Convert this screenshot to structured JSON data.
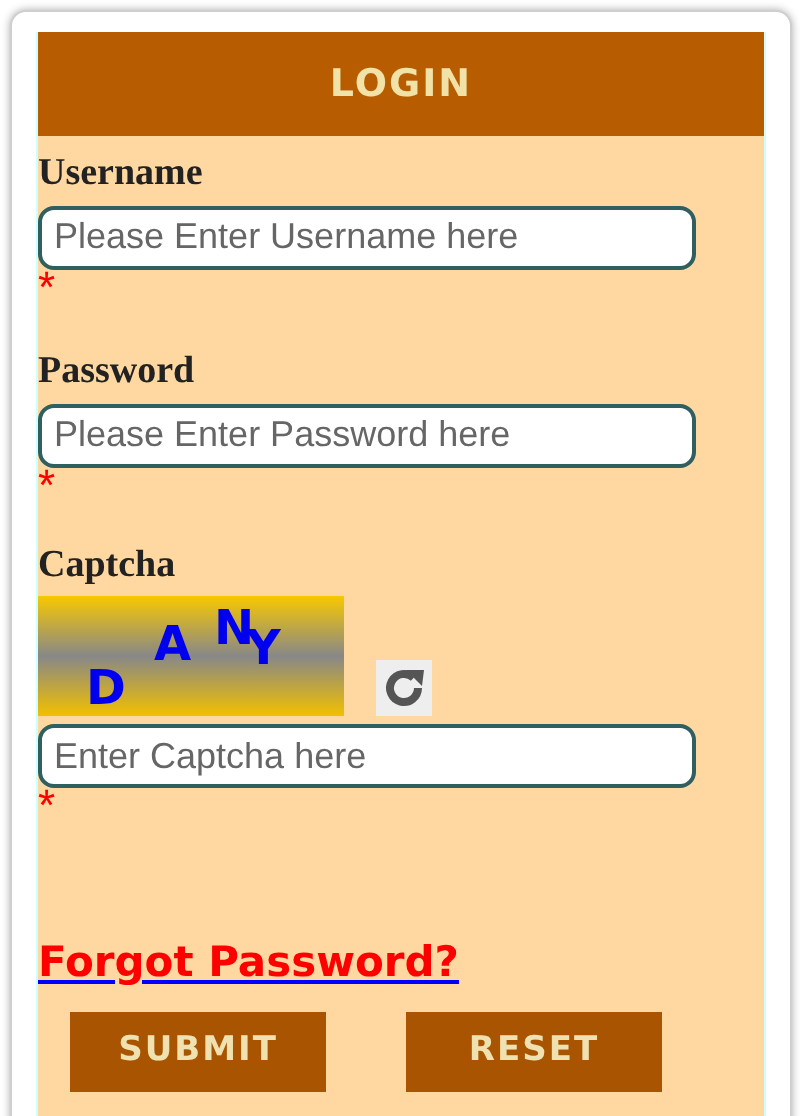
{
  "header": {
    "title": "LOGIN"
  },
  "fields": [
    {
      "label": "Username",
      "placeholder": "Please Enter Username here",
      "required_mark": "*"
    },
    {
      "label": "Password",
      "placeholder": "Please Enter Password here",
      "required_mark": "*"
    }
  ],
  "captcha": {
    "label": "Captcha",
    "letters": [
      "D",
      "A",
      "N",
      "Y"
    ],
    "placeholder": "Enter Captcha here",
    "required_mark": "*"
  },
  "forgot_link": "Forgot Password?",
  "buttons": [
    "SUBMIT",
    "RESET"
  ]
}
